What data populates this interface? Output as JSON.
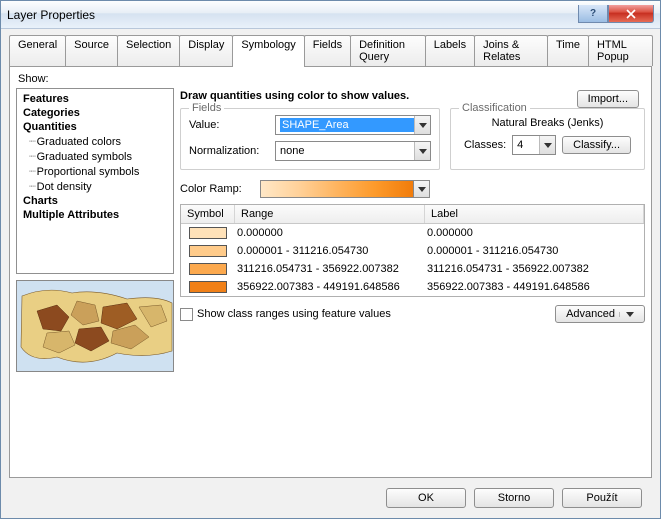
{
  "window": {
    "title": "Layer Properties"
  },
  "tabs": [
    "General",
    "Source",
    "Selection",
    "Display",
    "Symbology",
    "Fields",
    "Definition Query",
    "Labels",
    "Joins & Relates",
    "Time",
    "HTML Popup"
  ],
  "active_tab": "Symbology",
  "show_label": "Show:",
  "tree": {
    "features": "Features",
    "categories": "Categories",
    "quantities": "Quantities",
    "quantity_items": [
      "Graduated colors",
      "Graduated symbols",
      "Proportional symbols",
      "Dot density"
    ],
    "charts": "Charts",
    "multi": "Multiple Attributes"
  },
  "right": {
    "heading": "Draw quantities using color to show values.",
    "import": "Import...",
    "fields_legend": "Fields",
    "value_label": "Value:",
    "value_field": "SHAPE_Area",
    "norm_label": "Normalization:",
    "norm_field": "none",
    "class_legend": "Classification",
    "class_method": "Natural Breaks (Jenks)",
    "classes_label": "Classes:",
    "classes_count": "4",
    "classify_btn": "Classify...",
    "color_ramp_label": "Color Ramp:",
    "grid": {
      "symbol": "Symbol",
      "range": "Range",
      "label": "Label",
      "rows": [
        {
          "color": "#ffe2b9",
          "range": "0.000000",
          "label": "0.000000"
        },
        {
          "color": "#ffcb8a",
          "range": "0.000001 - 311216.054730",
          "label": "0.000001 - 311216.054730"
        },
        {
          "color": "#fca94e",
          "range": "311216.054731 - 356922.007382",
          "label": "311216.054731 - 356922.007382"
        },
        {
          "color": "#f08018",
          "range": "356922.007383 - 449191.648586",
          "label": "356922.007383 - 449191.648586"
        }
      ]
    },
    "show_ranges_label": "Show class ranges using feature values",
    "advanced": "Advanced"
  },
  "buttons": {
    "ok": "OK",
    "cancel": "Storno",
    "apply": "Použít"
  }
}
